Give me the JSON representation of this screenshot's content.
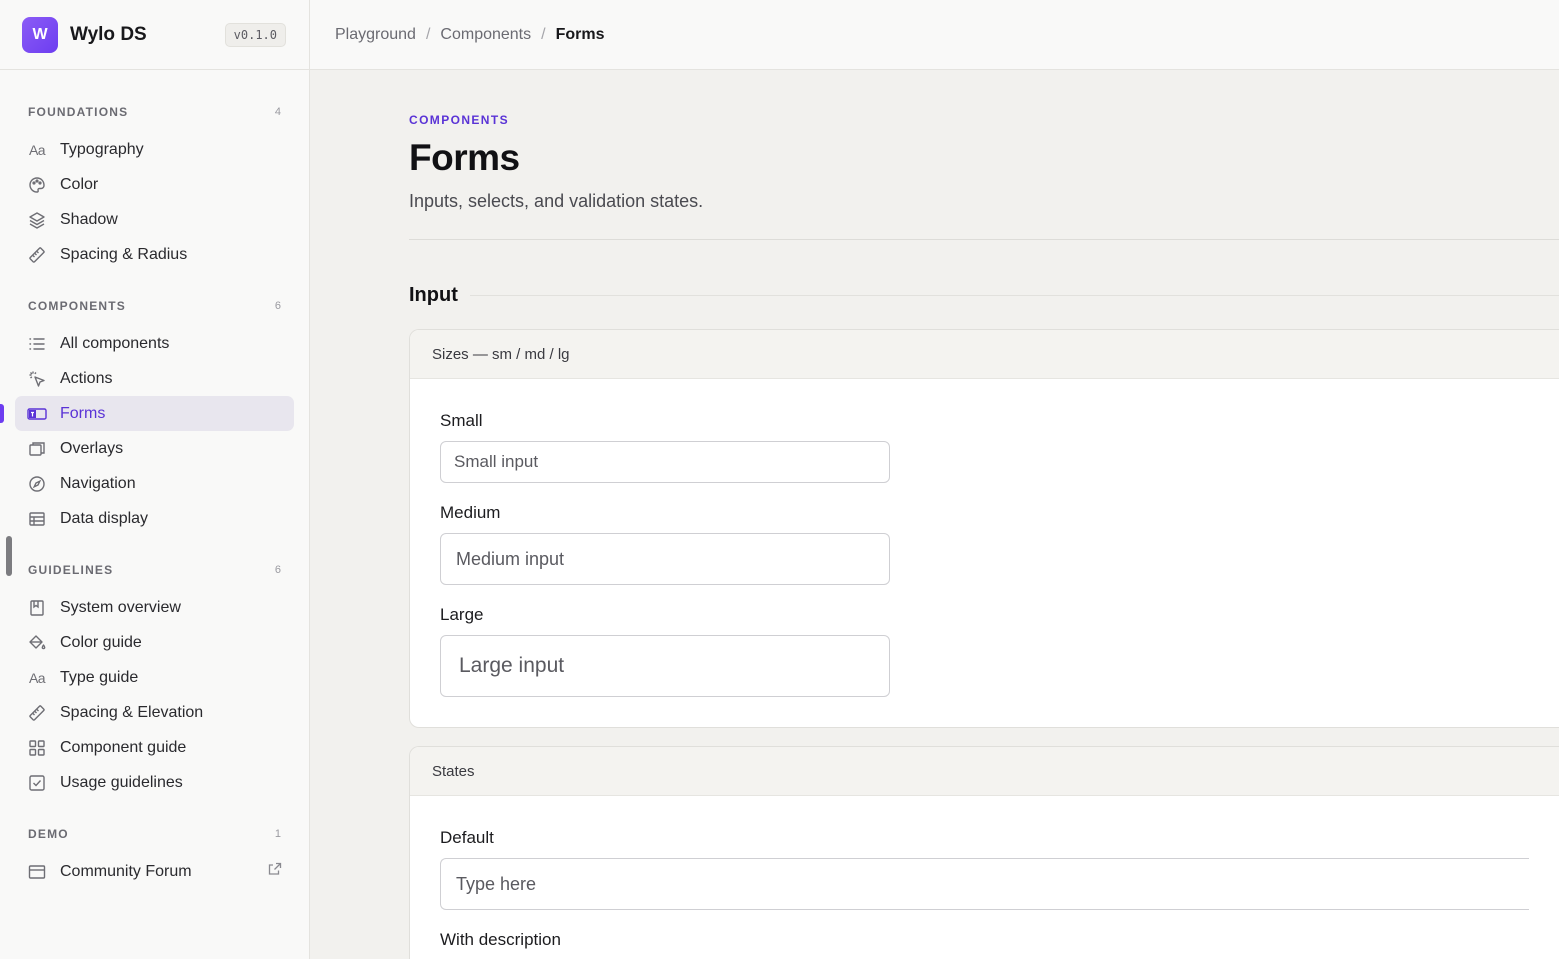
{
  "brand": {
    "logo_letter": "W",
    "name": "Wylo DS",
    "version": "v0.1.0"
  },
  "breadcrumb": [
    "Playground",
    "Components",
    "Forms"
  ],
  "sidebar": {
    "sections": [
      {
        "title": "FOUNDATIONS",
        "count": "4",
        "items": [
          {
            "label": "Typography",
            "icon": "typography-icon"
          },
          {
            "label": "Color",
            "icon": "palette-icon"
          },
          {
            "label": "Shadow",
            "icon": "layers-icon"
          },
          {
            "label": "Spacing & Radius",
            "icon": "ruler-icon"
          }
        ]
      },
      {
        "title": "COMPONENTS",
        "count": "6",
        "items": [
          {
            "label": "All components",
            "icon": "list-icon"
          },
          {
            "label": "Actions",
            "icon": "pointer-click-icon"
          },
          {
            "label": "Forms",
            "icon": "form-input-icon",
            "active": true
          },
          {
            "label": "Overlays",
            "icon": "window-stack-icon"
          },
          {
            "label": "Navigation",
            "icon": "compass-icon"
          },
          {
            "label": "Data display",
            "icon": "table-icon"
          }
        ]
      },
      {
        "title": "GUIDELINES",
        "count": "6",
        "items": [
          {
            "label": "System overview",
            "icon": "book-icon"
          },
          {
            "label": "Color guide",
            "icon": "paint-bucket-icon"
          },
          {
            "label": "Type guide",
            "icon": "typography-icon"
          },
          {
            "label": "Spacing & Elevation",
            "icon": "ruler-icon"
          },
          {
            "label": "Component guide",
            "icon": "grid-icon"
          },
          {
            "label": "Usage guidelines",
            "icon": "check-square-icon"
          }
        ]
      },
      {
        "title": "DEMO",
        "count": "1",
        "items": [
          {
            "label": "Community Forum",
            "icon": "browser-window-icon",
            "external": true
          }
        ]
      }
    ]
  },
  "main": {
    "eyebrow": "COMPONENTS",
    "title": "Forms",
    "subtitle": "Inputs, selects, and validation states.",
    "section_title": "Input",
    "sizes_card": {
      "header": "Sizes — sm / md / lg",
      "small_label": "Small",
      "small_placeholder": "Small input",
      "medium_label": "Medium",
      "medium_placeholder": "Medium input",
      "large_label": "Large",
      "large_placeholder": "Large input"
    },
    "states_card": {
      "header": "States",
      "default_label": "Default",
      "default_placeholder": "Type here",
      "description_label": "With description"
    }
  },
  "colors": {
    "accent": "#6d3df0",
    "accent_text": "#5a33d6",
    "active_bg": "#e8e6ee"
  }
}
